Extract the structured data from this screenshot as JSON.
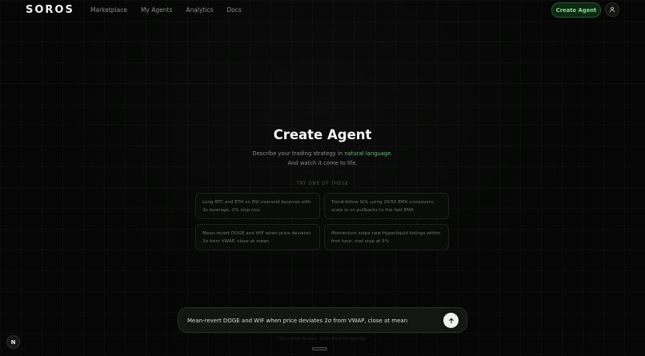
{
  "brand": {
    "logo_text": "SOROS"
  },
  "nav": {
    "links": [
      {
        "label": "Marketplace"
      },
      {
        "label": "My Agents"
      },
      {
        "label": "Analytics"
      },
      {
        "label": "Docs"
      }
    ],
    "create_button": "Create Agent",
    "avatar_icon": "user-icon"
  },
  "hero": {
    "title": "Create Agent",
    "subtitle_prefix": "Describe your trading strategy in ",
    "subtitle_accent": "natural language",
    "subtitle_suffix": ".",
    "subtitle_line2": "And watch it come to life."
  },
  "suggestions": {
    "label": "TRY ONE OF THESE",
    "items": [
      "Long BTC and ETH on RSI oversold bounces with 3x leverage, 2% stop loss",
      "Trend-follow SOL using 20/50 EMA crossovers, scale in on pullbacks to the fast EMA",
      "Mean-revert DOGE and WIF when price deviates 2σ from VWAP, close at mean",
      "Momentum snipe new Hyperliquid listings within first hour, trail stop at 5%"
    ]
  },
  "prompt": {
    "value": "Mean-revert DOGE and WIF when price deviates 2σ from VWAP, close at mean",
    "send_icon": "arrow-up-icon",
    "hint": "Press Enter to send · Shift+Enter for new line"
  },
  "corner_badge": {
    "label": "N"
  },
  "colors": {
    "background": "#050605",
    "accent": "#57c46a",
    "button_bg": "#0e2814"
  }
}
